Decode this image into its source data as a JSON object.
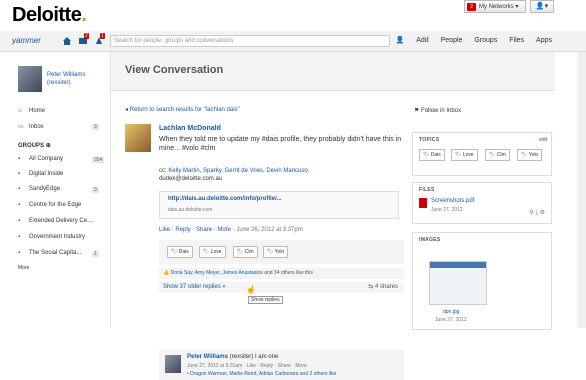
{
  "topbar": {
    "logo_text": "Deloitte",
    "logo_dot": ".",
    "my_networks_label": "My Networks ▾",
    "my_networks_badge": "2",
    "user_menu": "👤▾"
  },
  "nav": {
    "brand": "yammer",
    "messages_badge": "2",
    "notifications_badge": "1",
    "search_placeholder": "Search for people, groups and conversations",
    "add_label": "Add",
    "links": [
      "People",
      "Groups",
      "Files",
      "Apps"
    ]
  },
  "sidebar": {
    "user_name_1": "Peter Williams",
    "user_name_2": "(rexsiter)",
    "home": "Home",
    "inbox": "Inbox",
    "inbox_count": "3",
    "groups_label": "GROUPS",
    "groups": [
      {
        "label": "All Company",
        "count": "354"
      },
      {
        "label": "Digital Inside",
        "count": ""
      },
      {
        "label": "SandyEdge",
        "count": "3"
      },
      {
        "label": "Centre for the Edge",
        "count": ""
      },
      {
        "label": "Extended Delivery Ce...",
        "count": ""
      },
      {
        "label": "Government Industry",
        "count": ""
      },
      {
        "label": "The Social Capita...",
        "count": "1"
      }
    ],
    "more": "More"
  },
  "main": {
    "title": "View Conversation",
    "back_link": "Return to search results for \"lachlan dais\"",
    "message": {
      "author": "Lachlan McDonald",
      "text": "When they told me to update my #dais profile, they probably didn't have this in mine... #volo #clm",
      "cc_prefix": "cc: ",
      "cc_names": "Kelly Martin, Sparky, Gerrit de Vries, Devin Mancuso,",
      "cc_email": "dudek@deloitte.com.au",
      "link_title": "http://dais.au.deloitte.com/info/profile/...",
      "link_url": "dais.au.deloitte.com",
      "actions": "Like · Reply · Share · More",
      "timestamp": "· June 26, 2012 at 3:37pm",
      "tags": [
        "Dais",
        "Love",
        "Clm",
        "Yolo"
      ],
      "likes_names": "Doria Say, Amy Meyer, James Anastasios",
      "likes_suffix": "and 34 others like this",
      "older_replies": "Show 37 older replies »",
      "shares": "4 shares",
      "tooltip": "Show replies"
    },
    "reply": {
      "author": "Peter Williams",
      "author_handle": "(rexsiter) I am one",
      "meta": "June 27, 2012 at 9:31am · Like · Reply · Share · More",
      "more": "• Dragon Warman, Marlie Reed, Adrian Carbonara and 2 others like"
    }
  },
  "right": {
    "follow": "Follow in Inbox",
    "topics_label": "TOPICS",
    "topics_edit": "edit",
    "topics": [
      "Dais",
      "Love",
      "Clm",
      "Yolo"
    ],
    "files_label": "FILES",
    "file_name": "Screenshots.pdf",
    "file_date": "June 27, 2012",
    "images_label": "IMAGES",
    "image_name": "dpn.jpg",
    "image_date": "June 27, 2012"
  }
}
